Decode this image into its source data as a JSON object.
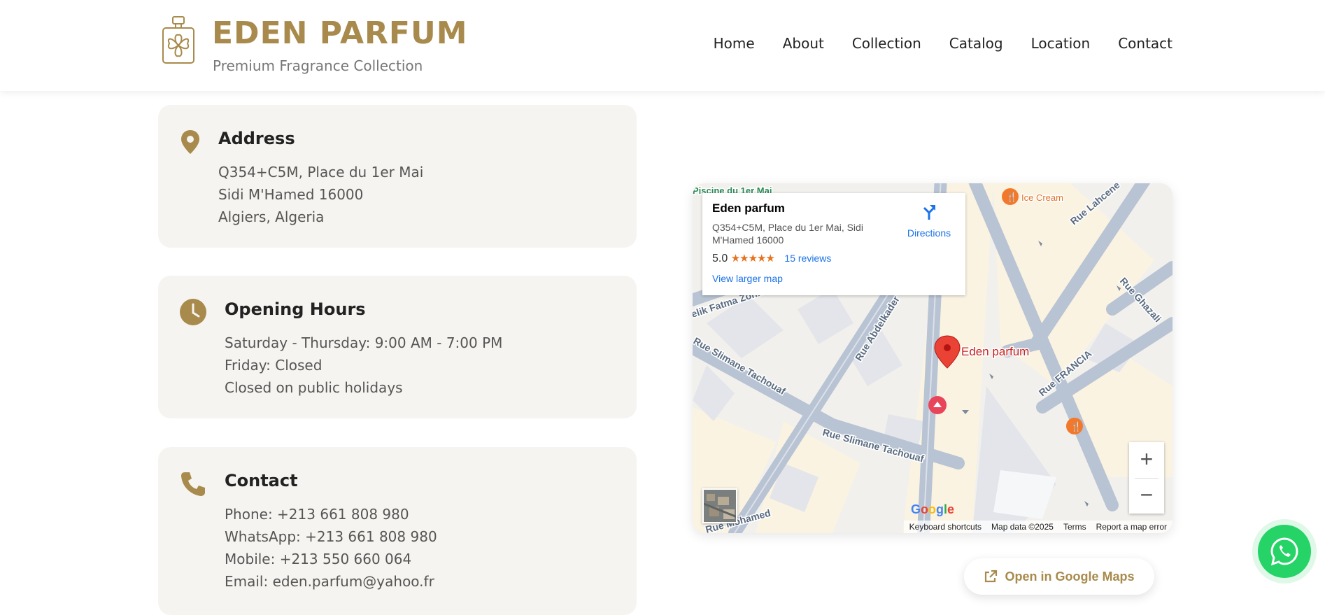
{
  "header": {
    "brand": "EDEN PARFUM",
    "tagline": "Premium Fragrance Collection",
    "nav": [
      "Home",
      "About",
      "Collection",
      "Catalog",
      "Location",
      "Contact"
    ]
  },
  "address": {
    "title": "Address",
    "lines": [
      "Q354+C5M, Place du 1er Mai",
      "Sidi M'Hamed 16000",
      "Algiers, Algeria"
    ]
  },
  "hours": {
    "title": "Opening Hours",
    "lines": [
      "Saturday - Thursday: 9:00 AM - 7:00 PM",
      "Friday: Closed",
      "Closed on public holidays"
    ]
  },
  "contact": {
    "title": "Contact",
    "lines": [
      "Phone: +213 661 808 980",
      "WhatsApp: +213 661 808 980",
      "Mobile: +213 550 660 064",
      "Email: eden.parfum@yahoo.fr"
    ]
  },
  "map": {
    "place_name": "Eden parfum",
    "place_address": "Q354+C5M, Place du 1er Mai, Sidi M'Hamed 16000",
    "rating": "5.0",
    "stars": "★★★★★",
    "reviews": "15 reviews",
    "larger_map": "View larger map",
    "directions": "Directions",
    "marker_label": "Eden parfum",
    "poi_ice_cream": "Ice Cream",
    "streets": [
      "Piscine du 1er Mai",
      "Rue Lahcene",
      "elik Fatma Zohra",
      "Rue Abdelkader",
      "Rue Ghazali",
      "Rue FRANCIA",
      "Rue Slimane Tachouaf",
      "Rue Slimane Tachouaf",
      "Rue Mohamed"
    ],
    "zoom_in": "+",
    "zoom_out": "−",
    "google": "Google",
    "footer": [
      "Keyboard shortcuts",
      "Map data ©2025",
      "Terms",
      "Report a map error"
    ]
  },
  "open_maps": "Open in Google Maps",
  "colors": {
    "accent": "#a88a4c",
    "card_bg": "#f6f4f0",
    "whatsapp": "#25d366"
  }
}
